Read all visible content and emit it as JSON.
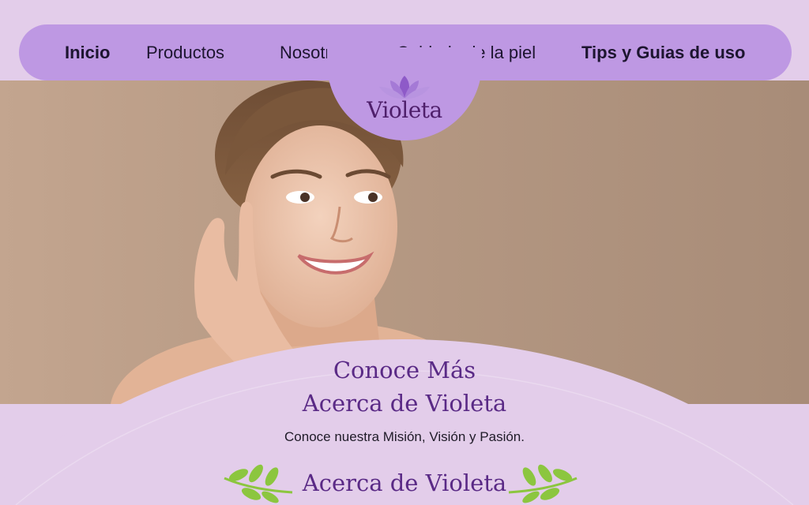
{
  "nav": {
    "items": [
      {
        "label": "Inicio",
        "bold": true
      },
      {
        "label": "Productos",
        "bold": false
      },
      {
        "label": "Nosotros",
        "bold": false
      },
      {
        "label": "Cuidado de la piel",
        "bold": false
      },
      {
        "label": "Tips y Guias de uso",
        "bold": true
      }
    ]
  },
  "logo": {
    "text": "Violeta",
    "icon": "lotus-icon"
  },
  "hero": {
    "image": "smiling-woman-photo"
  },
  "about": {
    "title_line1": "Conoce Más",
    "title_line2": "Acerca de Violeta",
    "subtitle": "Conoce nuestra Misión, Visión y Pasión.",
    "section_title": "Acerca de Violeta",
    "decor_icon": "leaf-branch-icon"
  },
  "colors": {
    "page_bg": "#e3cdea",
    "nav_bg": "#be98e3",
    "accent_text": "#5a2a86",
    "leaf_green": "#8cc63f"
  }
}
